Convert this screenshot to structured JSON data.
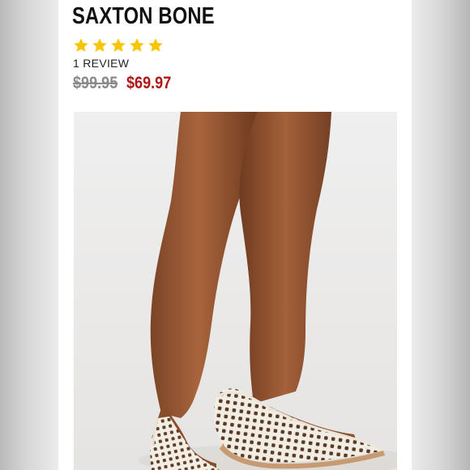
{
  "product": {
    "title": "SAXTON BONE",
    "rating_stars": 5,
    "review_count": "1 REVIEW",
    "price_original": "$99.95",
    "price_sale": "$69.97"
  },
  "colors": {
    "star": "#f7c600",
    "sale_price": "#b01414",
    "original_price": "#8a8a8a"
  },
  "icons": [
    "star-icon"
  ]
}
